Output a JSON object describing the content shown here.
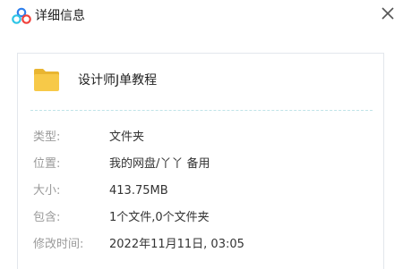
{
  "window": {
    "title": "详细信息",
    "close_icon": "close-icon",
    "app_icon": "baidu-netdisk-cloud-icon"
  },
  "file": {
    "name": "设计师J单教程",
    "icon": "folder-icon"
  },
  "details": [
    {
      "key": "type",
      "label": "类型:",
      "value": "文件夹"
    },
    {
      "key": "location",
      "label": "位置:",
      "value": "我的网盘/丫丫 备用"
    },
    {
      "key": "size",
      "label": "大小:",
      "value": "413.75MB"
    },
    {
      "key": "contains",
      "label": "包含:",
      "value": "1个文件,0个文件夹"
    },
    {
      "key": "modified",
      "label": "修改时间:",
      "value": "2022年11月11日, 03:05"
    }
  ],
  "colors": {
    "folder": "#f7c948",
    "folder_dark": "#e9b531",
    "logo_blue": "#2f80ed",
    "logo_cyan": "#2ec5e6",
    "logo_red": "#f0413b"
  }
}
